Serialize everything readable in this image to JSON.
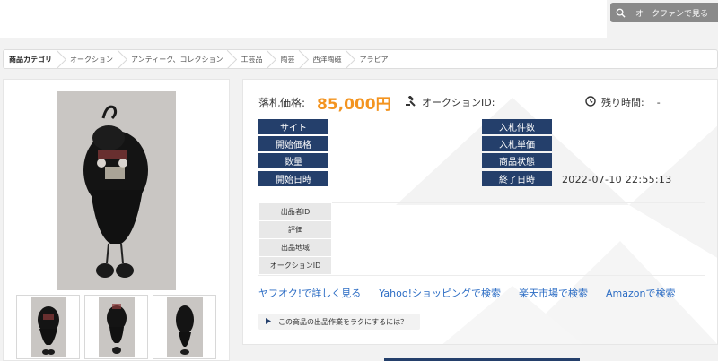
{
  "header": {
    "search_button_label": "オークファンで見る"
  },
  "breadcrumb": [
    "商品カテゴリ",
    "オークション",
    "アンティーク、コレクション",
    "工芸品",
    "陶芸",
    "西洋陶磁",
    "アラビア"
  ],
  "auction": {
    "price_label": "落札価格:",
    "price_value": "85,000円",
    "auction_id_label": "オークションID:",
    "remaining_label": "残り時間:",
    "remaining_value": "-",
    "labels_left": [
      "サイト",
      "開始価格",
      "数量",
      "開始日時"
    ],
    "labels_right": [
      "入札件数",
      "入札単価",
      "商品状態",
      "終了日時"
    ],
    "end_date_value": "2022-07-10 22:55:13"
  },
  "seller": {
    "rows": [
      "出品者ID",
      "評価",
      "出品地域",
      "オークションID"
    ]
  },
  "links": [
    "ヤフオク!で詳しく見る",
    "Yahoo!ショッピングで検索",
    "楽天市場で検索",
    "Amazonで検索"
  ],
  "tip": {
    "text": "この商品の出品作業をラクにするには？"
  },
  "colors": {
    "accent_price": "#f39420",
    "label_navy": "#243f6b",
    "link_blue": "#2b6cc4"
  },
  "icons": [
    "search-icon",
    "gavel-icon",
    "clock-icon",
    "triangle-right-icon"
  ]
}
